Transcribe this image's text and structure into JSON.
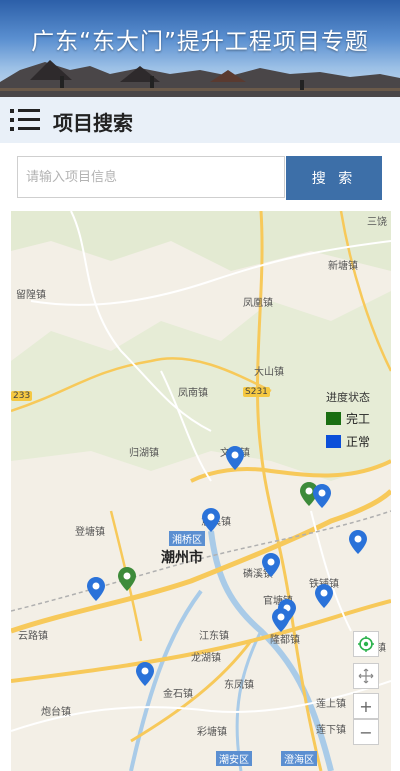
{
  "header": {
    "title": "广东“东大门”提升工程项目专题"
  },
  "section": {
    "title": "项目搜索"
  },
  "search": {
    "placeholder": "请输入项目信息",
    "button_label": "搜 索"
  },
  "legend": {
    "title": "进度状态",
    "items": [
      {
        "label": "完工",
        "color": "#1a6e12"
      },
      {
        "label": "正常",
        "color": "#0b4fd9"
      }
    ]
  },
  "map": {
    "places": [
      {
        "name": "三饶",
        "kind": "town"
      },
      {
        "name": "留隍镇",
        "kind": "town"
      },
      {
        "name": "新塘镇",
        "kind": "town"
      },
      {
        "name": "凤凰镇",
        "kind": "town"
      },
      {
        "name": "大山镇",
        "kind": "town"
      },
      {
        "name": "凤南镇",
        "kind": "town"
      },
      {
        "name": "归湖镇",
        "kind": "town"
      },
      {
        "name": "文祠镇",
        "kind": "town"
      },
      {
        "name": "登塘镇",
        "kind": "town"
      },
      {
        "name": "意溪镇",
        "kind": "town"
      },
      {
        "name": "潮州市",
        "kind": "city"
      },
      {
        "name": "磷溪镇",
        "kind": "town"
      },
      {
        "name": "铁铺镇",
        "kind": "town"
      },
      {
        "name": "官塘镇",
        "kind": "town"
      },
      {
        "name": "云路镇",
        "kind": "town"
      },
      {
        "name": "江东镇",
        "kind": "town"
      },
      {
        "name": "隆都镇",
        "kind": "town"
      },
      {
        "name": "龙湖镇",
        "kind": "town"
      },
      {
        "name": "东凤镇",
        "kind": "town"
      },
      {
        "name": "金石镇",
        "kind": "town"
      },
      {
        "name": "炮台镇",
        "kind": "town"
      },
      {
        "name": "彩塘镇",
        "kind": "town"
      },
      {
        "name": "莲上镇",
        "kind": "town"
      },
      {
        "name": "莲下镇",
        "kind": "town"
      },
      {
        "name": "云澄镇",
        "kind": "town"
      }
    ],
    "districts": [
      "湘桥区",
      "潮安区",
      "澄海区"
    ],
    "road_shields": [
      "S231",
      "233"
    ],
    "pins": [
      {
        "status": "正常"
      },
      {
        "status": "完工"
      },
      {
        "status": "正常"
      },
      {
        "status": "正常"
      },
      {
        "status": "完工"
      },
      {
        "status": "正常"
      },
      {
        "status": "正常"
      },
      {
        "status": "正常"
      },
      {
        "status": "正常"
      },
      {
        "status": "正常"
      },
      {
        "status": "正常"
      },
      {
        "status": "正常"
      }
    ]
  },
  "controls": {
    "zoom_in": "+",
    "zoom_out": "−"
  }
}
